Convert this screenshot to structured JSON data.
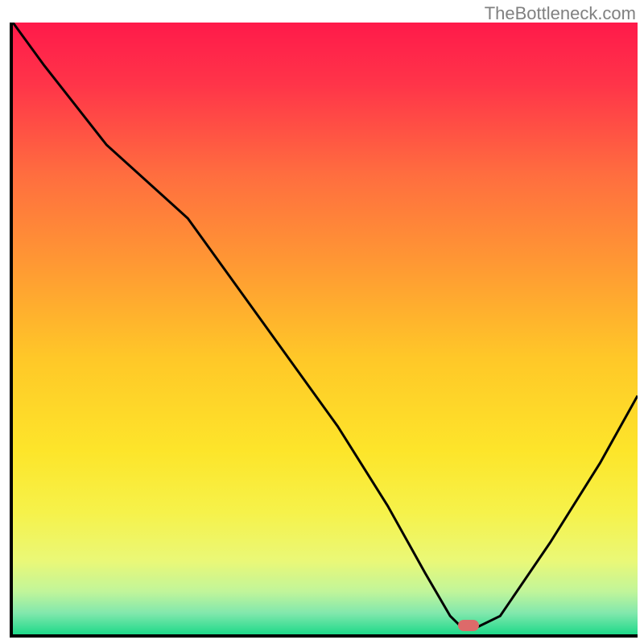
{
  "watermark": "TheBottleneck.com",
  "chart_data": {
    "type": "line",
    "title": "",
    "xlabel": "",
    "ylabel": "",
    "x_range": [
      0,
      100
    ],
    "y_range": [
      0,
      100
    ],
    "grid": false,
    "legend": false,
    "gradient_background": {
      "direction": "vertical",
      "stops": [
        {
          "pos": 0.0,
          "color": "#ff1a4a"
        },
        {
          "pos": 0.1,
          "color": "#ff3449"
        },
        {
          "pos": 0.25,
          "color": "#ff6e3f"
        },
        {
          "pos": 0.4,
          "color": "#ff9a33"
        },
        {
          "pos": 0.55,
          "color": "#ffc828"
        },
        {
          "pos": 0.7,
          "color": "#fde52a"
        },
        {
          "pos": 0.8,
          "color": "#f6f24a"
        },
        {
          "pos": 0.88,
          "color": "#eaf877"
        },
        {
          "pos": 0.93,
          "color": "#c1f59a"
        },
        {
          "pos": 0.965,
          "color": "#82e8ad"
        },
        {
          "pos": 1.0,
          "color": "#1fd98a"
        }
      ]
    },
    "series": [
      {
        "name": "bottleneck-curve",
        "color": "#000000",
        "x": [
          0,
          5,
          15,
          28,
          40,
          52,
          60,
          66,
          70,
          72,
          74,
          78,
          86,
          94,
          100
        ],
        "y": [
          100,
          93,
          80,
          68,
          51,
          34,
          21,
          10,
          3,
          1,
          1,
          3,
          15,
          28,
          39
        ]
      }
    ],
    "marker": {
      "name": "optimal-point",
      "x": 73,
      "y": 1.5,
      "color": "#dd6a6a"
    }
  }
}
